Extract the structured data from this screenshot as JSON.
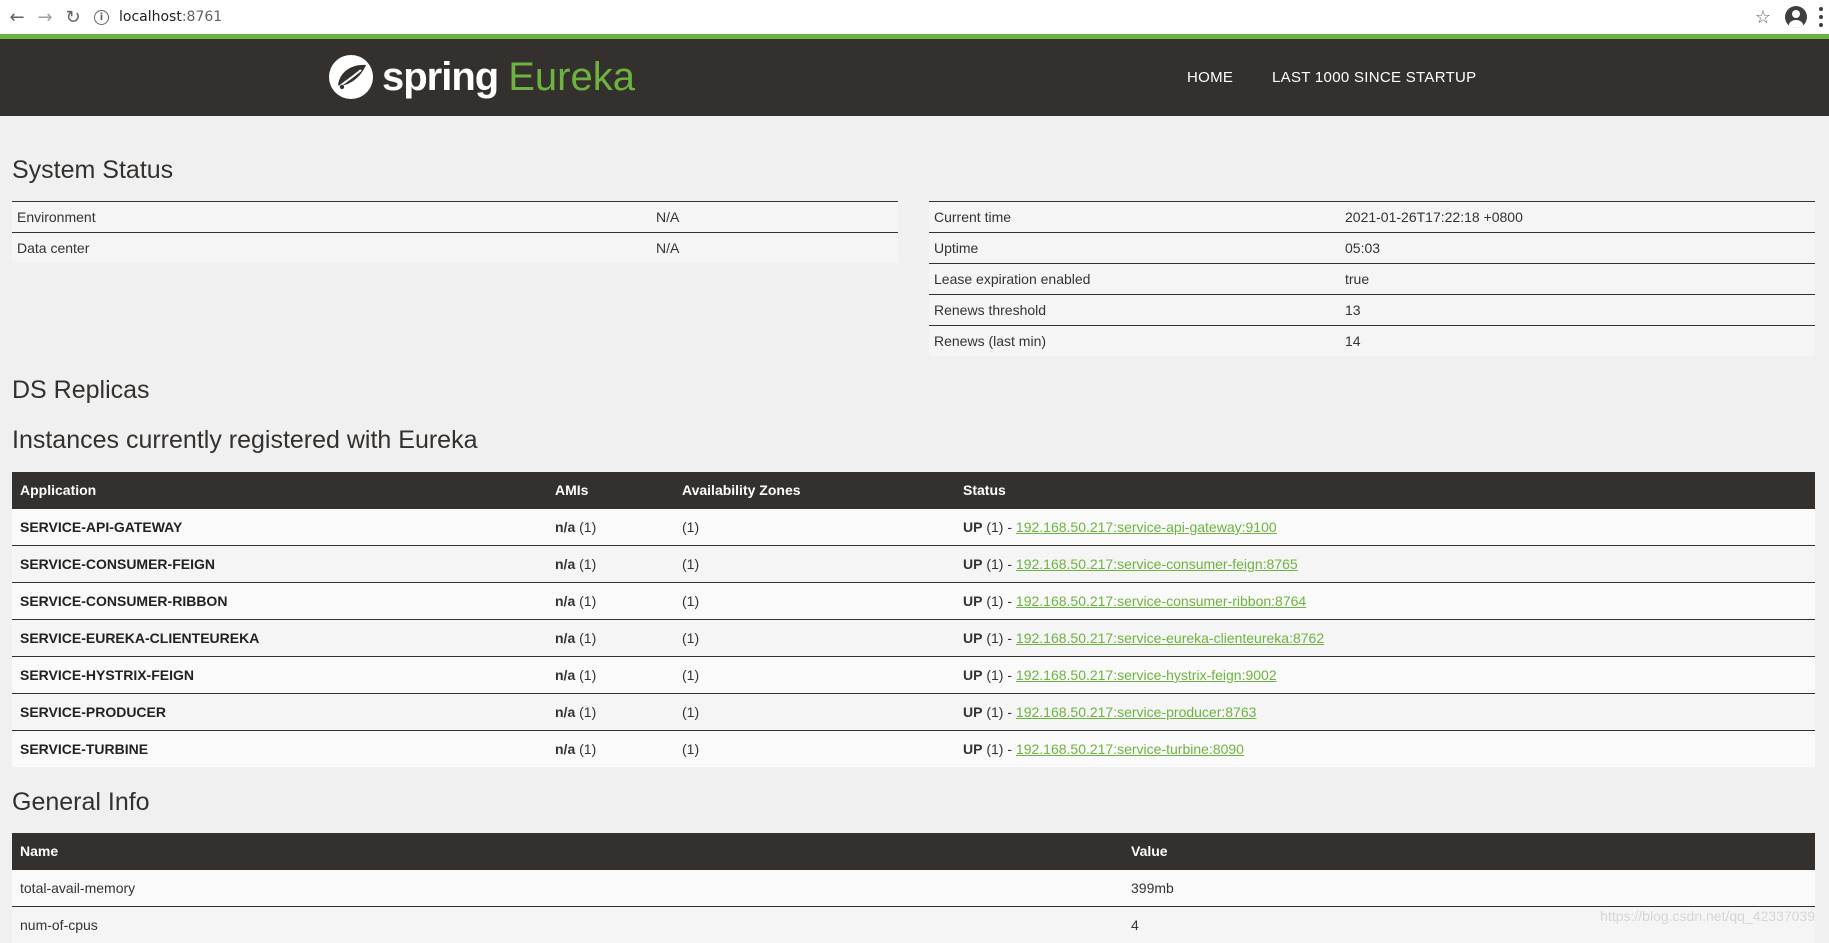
{
  "browser": {
    "url_host": "localhost",
    "url_port": ":8761",
    "back_icon": "arrow-left",
    "forward_icon": "arrow-right",
    "reload_icon": "reload",
    "info_icon": "info",
    "star_icon": "star",
    "account_icon": "account",
    "menu_icon": "kebab-menu"
  },
  "header": {
    "logo_spring": "spring",
    "logo_eureka": "Eureka",
    "nav": [
      "HOME",
      "LAST 1000 SINCE STARTUP"
    ]
  },
  "colors": {
    "brand_green": "#6db33f",
    "header_bg": "#34302d"
  },
  "system_status": {
    "title": "System Status",
    "left": [
      {
        "label": "Environment",
        "value": "N/A"
      },
      {
        "label": "Data center",
        "value": "N/A"
      }
    ],
    "right": [
      {
        "label": "Current time",
        "value": "2021-01-26T17:22:18 +0800"
      },
      {
        "label": "Uptime",
        "value": "05:03"
      },
      {
        "label": "Lease expiration enabled",
        "value": "true"
      },
      {
        "label": "Renews threshold",
        "value": "13"
      },
      {
        "label": "Renews (last min)",
        "value": "14"
      }
    ]
  },
  "ds_replicas": {
    "title": "DS Replicas"
  },
  "instances": {
    "title": "Instances currently registered with Eureka",
    "columns": [
      "Application",
      "AMIs",
      "Availability Zones",
      "Status"
    ],
    "rows": [
      {
        "app": "SERVICE-API-GATEWAY",
        "ami": "n/a",
        "ami_count": "(1)",
        "zones": "(1)",
        "status": "UP",
        "status_count": "(1) - ",
        "link": "192.168.50.217:service-api-gateway:9100"
      },
      {
        "app": "SERVICE-CONSUMER-FEIGN",
        "ami": "n/a",
        "ami_count": "(1)",
        "zones": "(1)",
        "status": "UP",
        "status_count": "(1) - ",
        "link": "192.168.50.217:service-consumer-feign:8765"
      },
      {
        "app": "SERVICE-CONSUMER-RIBBON",
        "ami": "n/a",
        "ami_count": "(1)",
        "zones": "(1)",
        "status": "UP",
        "status_count": "(1) - ",
        "link": "192.168.50.217:service-consumer-ribbon:8764"
      },
      {
        "app": "SERVICE-EUREKA-CLIENTEUREKA",
        "ami": "n/a",
        "ami_count": "(1)",
        "zones": "(1)",
        "status": "UP",
        "status_count": "(1) - ",
        "link": "192.168.50.217:service-eureka-clienteureka:8762"
      },
      {
        "app": "SERVICE-HYSTRIX-FEIGN",
        "ami": "n/a",
        "ami_count": "(1)",
        "zones": "(1)",
        "status": "UP",
        "status_count": "(1) - ",
        "link": "192.168.50.217:service-hystrix-feign:9002"
      },
      {
        "app": "SERVICE-PRODUCER",
        "ami": "n/a",
        "ami_count": "(1)",
        "zones": "(1)",
        "status": "UP",
        "status_count": "(1) - ",
        "link": "192.168.50.217:service-producer:8763"
      },
      {
        "app": "SERVICE-TURBINE",
        "ami": "n/a",
        "ami_count": "(1)",
        "zones": "(1)",
        "status": "UP",
        "status_count": "(1) - ",
        "link": "192.168.50.217:service-turbine:8090"
      }
    ]
  },
  "general_info": {
    "title": "General Info",
    "columns": [
      "Name",
      "Value"
    ],
    "rows": [
      {
        "name": "total-avail-memory",
        "value": "399mb"
      },
      {
        "name": "num-of-cpus",
        "value": "4"
      }
    ]
  },
  "watermark": "https://blog.csdn.net/qq_42337039"
}
